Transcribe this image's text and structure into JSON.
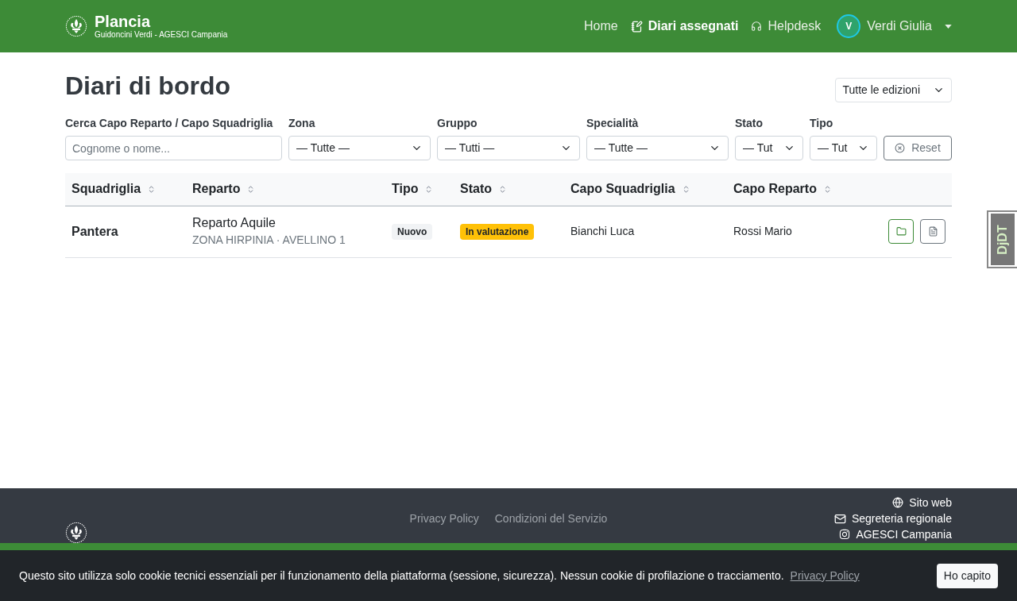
{
  "header": {
    "title": "Plancia",
    "subtitle": "Guidoncini Verdi - AGESCI Campania",
    "nav": [
      {
        "label": "Home",
        "kind": "plain",
        "selected": false
      },
      {
        "label": "Diari assegnati",
        "kind": "notebook",
        "selected": true
      },
      {
        "label": "Helpdesk",
        "kind": "headphones",
        "selected": false
      }
    ],
    "user": {
      "initial": "V",
      "name": "Verdi Giulia"
    }
  },
  "page": {
    "title": "Diari di bordo",
    "edition_select": "Tutte le edizioni"
  },
  "filters": [
    {
      "label": "Cerca Capo Reparto / Capo Squadriglia",
      "kind": "text",
      "placeholder": "Cognome o nome..."
    },
    {
      "label": "Zona",
      "kind": "select",
      "value": "— Tutte —"
    },
    {
      "label": "Gruppo",
      "kind": "select",
      "value": "— Tutti —"
    },
    {
      "label": "Specialità",
      "kind": "select",
      "value": "— Tutte —"
    },
    {
      "label": "Stato",
      "kind": "select",
      "value": "— Tut"
    },
    {
      "label": "Tipo",
      "kind": "select",
      "value": "— Tut"
    }
  ],
  "reset_button": "Reset",
  "table": {
    "columns": [
      "Squadriglia",
      "Reparto",
      "Tipo",
      "Stato",
      "Capo Squadriglia",
      "Capo Reparto"
    ],
    "rows": [
      {
        "squadriglia": "Pantera",
        "reparto": "Reparto Aquile",
        "reparto_location": "ZONA HIRPINIA · AVELLINO 1",
        "tipo": "Nuovo",
        "stato": "In valutazione",
        "capo_squadriglia": "Bianchi Luca",
        "capo_reparto": "Rossi Mario"
      }
    ]
  },
  "footer": {
    "links": [
      "Privacy Policy",
      "Condizioni del Servizio"
    ],
    "contacts": [
      {
        "kind": "globe",
        "label": "Sito web"
      },
      {
        "kind": "mail",
        "label": "Segreteria regionale"
      },
      {
        "kind": "instagram",
        "label": "AGESCI Campania"
      }
    ]
  },
  "cookie_banner": {
    "text": "Questo sito utilizza solo cookie tecnici essenziali per il funzionamento della piattaforma (sessione, sicurezza). Nessun cookie di profilazione o tracciamento.",
    "link": "Privacy Policy",
    "button": "Ho capito"
  },
  "debug_toolbar": {
    "label": "DjDT"
  }
}
